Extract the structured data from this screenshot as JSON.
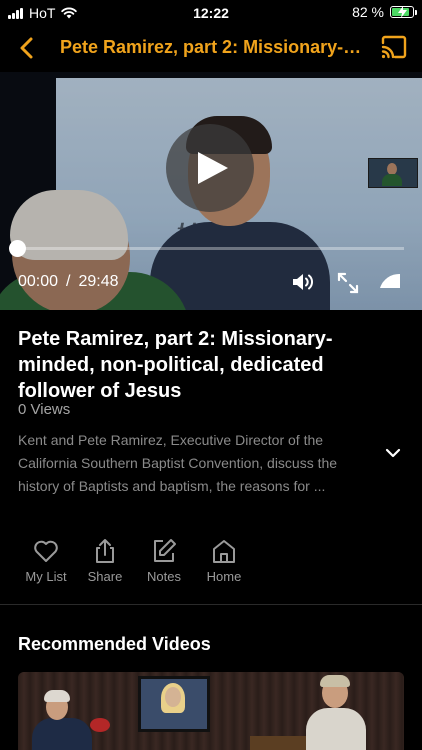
{
  "status_bar": {
    "carrier": "HoT",
    "time": "12:22",
    "battery_percent": "82 %",
    "battery_level": 0.82,
    "icons": [
      "signal-icon",
      "wifi-icon",
      "battery-charging-icon"
    ]
  },
  "nav": {
    "back_icon": "chevron-left-icon",
    "title": "Pete Ramirez, part 2: Missionary-minded, non-political, dedicated follower of Jesus",
    "cast_icon": "cast-icon"
  },
  "player": {
    "current_time": "00:00",
    "separator": "/",
    "duration": "29:48",
    "progress": 0.0,
    "wall_text": "tters",
    "icons": [
      "play-icon",
      "volume-icon",
      "fullscreen-icon",
      "playback-speed-icon"
    ]
  },
  "video": {
    "title": "Pete Ramirez, part 2: Missionary-minded, non-political, dedicated follower of Jesus",
    "views": "0 Views",
    "description": "Kent and Pete Ramirez, Executive Director of the California Southern Baptist Convention, discuss the history of Baptists and baptism, the reasons for ..."
  },
  "actions": {
    "my_list": "My List",
    "share": "Share",
    "notes": "Notes",
    "home": "Home"
  },
  "recommended": {
    "heading": "Recommended Videos"
  },
  "colors": {
    "accent": "#f0a31c",
    "background": "#000000",
    "muted_text": "#8a8a8a"
  }
}
